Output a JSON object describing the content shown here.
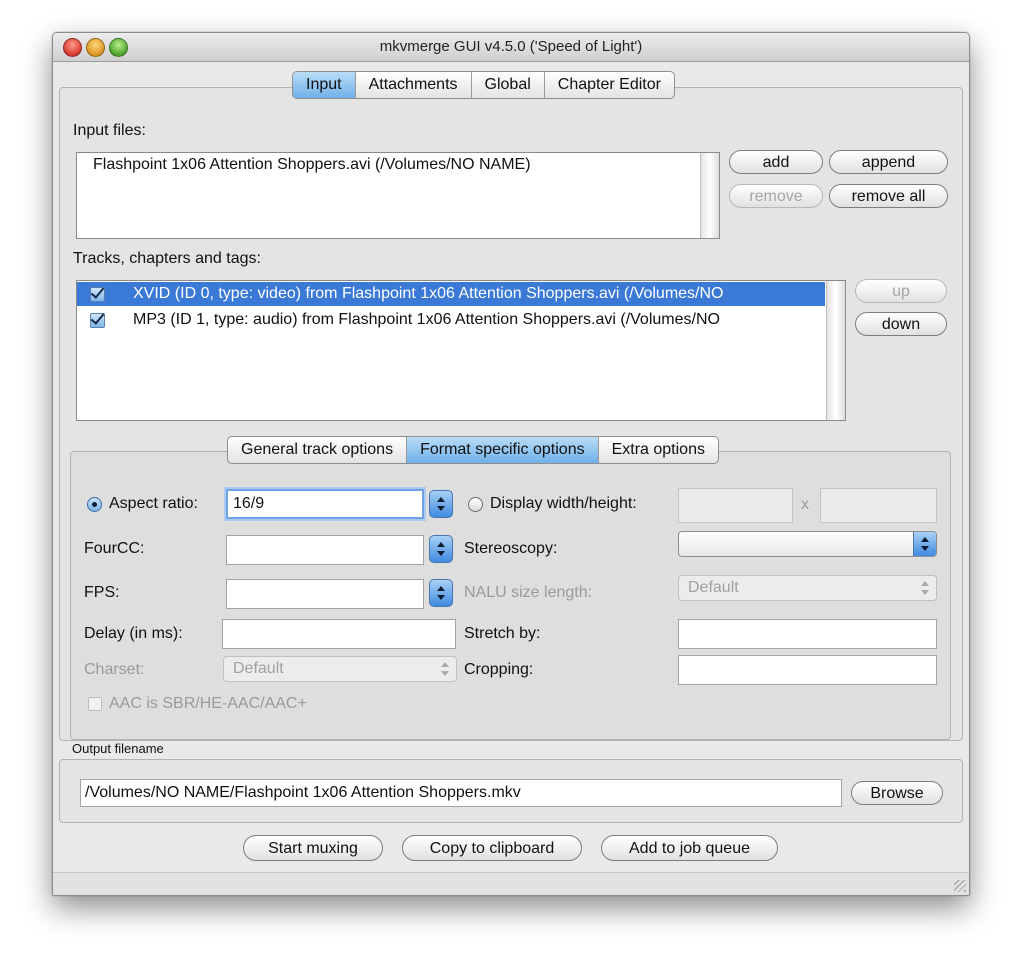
{
  "window": {
    "title": "mkvmerge GUI v4.5.0 ('Speed of Light')"
  },
  "main_tabs": [
    {
      "label": "Input",
      "active": true
    },
    {
      "label": "Attachments",
      "active": false
    },
    {
      "label": "Global",
      "active": false
    },
    {
      "label": "Chapter Editor",
      "active": false
    }
  ],
  "input": {
    "input_files_label": "Input files:",
    "input_files": [
      "Flashpoint 1x06 Attention Shoppers.avi (/Volumes/NO NAME)"
    ],
    "buttons": {
      "add": "add",
      "append": "append",
      "remove": "remove",
      "remove_all": "remove all"
    },
    "tracks_label": "Tracks, chapters and tags:",
    "tracks": [
      {
        "text": "XVID (ID 0, type: video) from Flashpoint 1x06 Attention Shoppers.avi (/Volumes/NO",
        "checked": true,
        "selected": true
      },
      {
        "text": "MP3 (ID 1, type: audio) from Flashpoint 1x06 Attention Shoppers.avi (/Volumes/NO",
        "checked": true,
        "selected": false
      }
    ],
    "track_buttons": {
      "up": "up",
      "down": "down"
    }
  },
  "track_tabs": [
    {
      "label": "General track options",
      "active": false
    },
    {
      "label": "Format specific options",
      "active": true
    },
    {
      "label": "Extra options",
      "active": false
    }
  ],
  "format_options": {
    "aspect_ratio_label": "Aspect ratio:",
    "aspect_ratio_value": "16/9",
    "display_wh_label": "Display width/height:",
    "display_wh_separator": "x",
    "fourcc_label": "FourCC:",
    "stereoscopy_label": "Stereoscopy:",
    "fps_label": "FPS:",
    "nalu_label": "NALU size length:",
    "nalu_value": "Default",
    "delay_label": "Delay (in ms):",
    "stretch_label": "Stretch by:",
    "charset_label": "Charset:",
    "charset_value": "Default",
    "cropping_label": "Cropping:",
    "aac_label": "AAC is SBR/HE-AAC/AAC+"
  },
  "output": {
    "label": "Output filename",
    "filename": "/Volumes/NO NAME/Flashpoint 1x06 Attention Shoppers.mkv",
    "browse": "Browse"
  },
  "actions": {
    "start": "Start muxing",
    "copy": "Copy to clipboard",
    "queue": "Add to job queue"
  }
}
